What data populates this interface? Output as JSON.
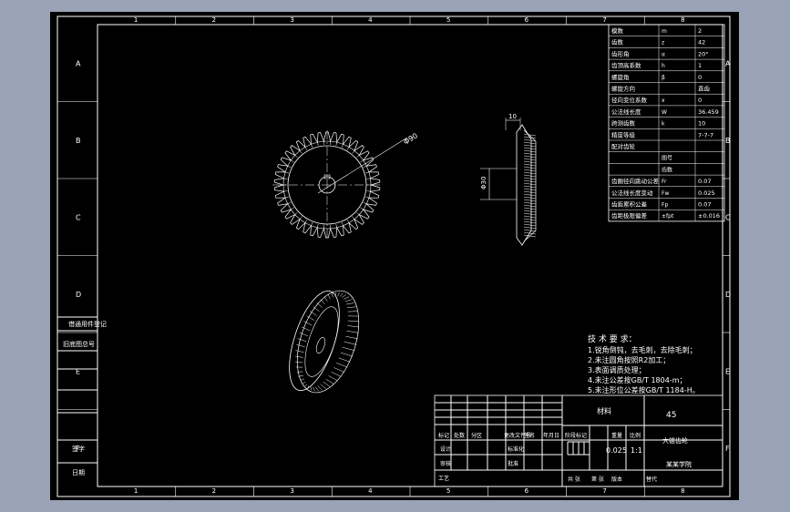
{
  "frame": {
    "cols": [
      "1",
      "2",
      "3",
      "4",
      "5",
      "6",
      "7",
      "8"
    ],
    "rows": [
      "A",
      "B",
      "C",
      "D",
      "E",
      "F"
    ]
  },
  "left_strip": {
    "labels": [
      "借通用件登记",
      "旧底图总号",
      "",
      "签字",
      "日期"
    ]
  },
  "param_table": {
    "rows": [
      {
        "name": "模数",
        "sym": "m",
        "val": "2"
      },
      {
        "name": "齿数",
        "sym": "z",
        "val": "42"
      },
      {
        "name": "齿形角",
        "sym": "α",
        "val": "20°"
      },
      {
        "name": "齿顶高系数",
        "sym": "h",
        "val": "1"
      },
      {
        "name": "螺旋角",
        "sym": "β",
        "val": "0"
      },
      {
        "name": "螺旋方向",
        "sym": "",
        "val": "直齿"
      },
      {
        "name": "径向变位系数",
        "sym": "x",
        "val": "0"
      },
      {
        "name": "公法线长度",
        "sym": "W",
        "val": "36.459"
      },
      {
        "name": "跨测齿数",
        "sym": "k",
        "val": "10"
      },
      {
        "name": "精度等级",
        "sym": "",
        "val": "7-7-7"
      },
      {
        "name": "配对齿轮",
        "sym": "",
        "val": ""
      },
      {
        "name": "",
        "sym": "图号",
        "val": ""
      },
      {
        "name": "",
        "sym": "齿数",
        "val": ""
      },
      {
        "name": "齿圈径向跳动公差",
        "sym": "Fr",
        "val": "0.07"
      },
      {
        "name": "公法线长度变动",
        "sym": "Fw",
        "val": "0.025"
      },
      {
        "name": "齿距累积公差",
        "sym": "Fp",
        "val": "0.07"
      },
      {
        "name": "齿距极限偏差",
        "sym": "±fpt",
        "val": "±0.016"
      }
    ]
  },
  "dimensions": {
    "front_diameter": "Φ90",
    "side_width": "10",
    "side_bore": "Φ30"
  },
  "tech_req": {
    "title": "技 术 要 求：",
    "items": [
      "1.锐角倒钝，去毛刺，去除毛刺；",
      "2.未注圆角按照R2加工；",
      "3.表面调质处理；",
      "4.未注公差按GB/T 1804-m；",
      "5.未注形位公差按GB/T 1184-H。"
    ]
  },
  "title_block": {
    "material_label": "材料",
    "material": "45",
    "part_name": "大锥齿轮",
    "school": "某某学院",
    "weight": "0.025",
    "scale": "1:1",
    "headers": [
      "标记",
      "处数",
      "分区",
      "更改文件号",
      "签名",
      "年月日"
    ],
    "roles": [
      "设计",
      "审核",
      "工艺"
    ],
    "mid_labels": [
      "标准化",
      "批准"
    ],
    "stage_labels": [
      "阶段标记",
      "重量",
      "比例"
    ],
    "bottom": [
      "共 张",
      "第 张",
      "版本",
      "替代"
    ]
  }
}
